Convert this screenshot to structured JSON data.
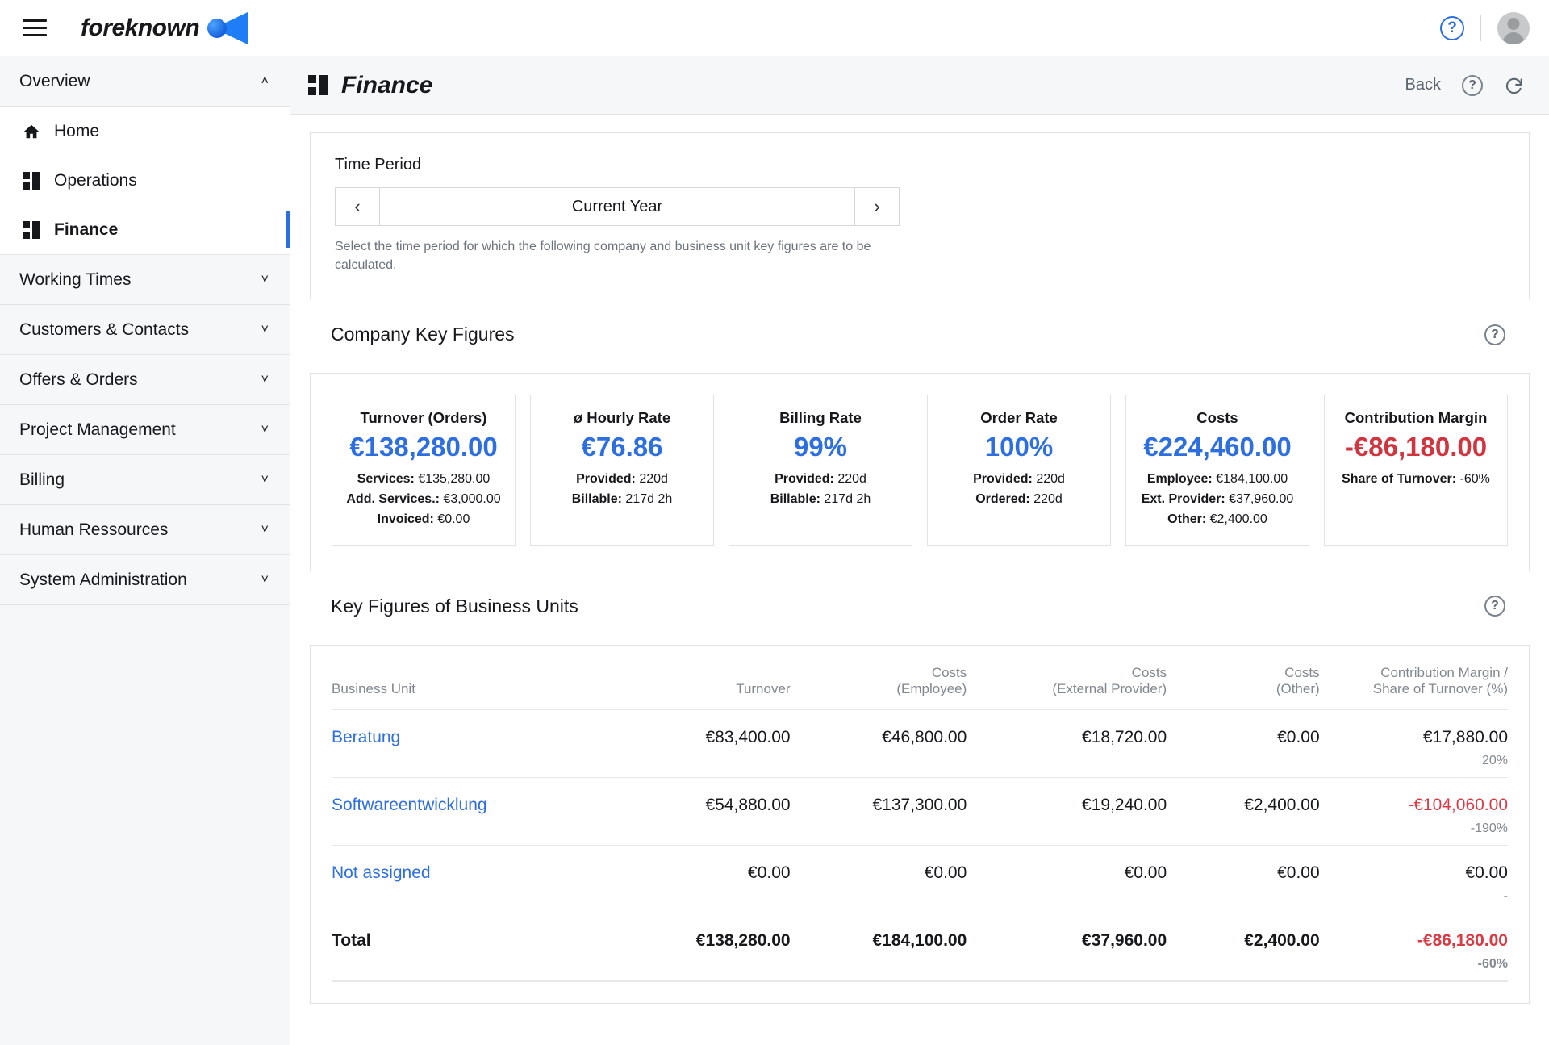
{
  "topbar": {
    "brand_name": "foreknown",
    "menu_icon": "hamburger-icon",
    "help_icon": "help-circle-icon",
    "avatar_icon": "user-avatar-icon"
  },
  "sidebar": {
    "groups": [
      {
        "label": "Overview",
        "expanded": true,
        "chevron": "˄",
        "items": [
          {
            "label": "Home",
            "icon": "home-icon",
            "active": false
          },
          {
            "label": "Operations",
            "icon": "grid-icon",
            "active": false
          },
          {
            "label": "Finance",
            "icon": "grid-icon",
            "active": true
          }
        ]
      },
      {
        "label": "Working Times",
        "expanded": false,
        "chevron": "˅",
        "items": []
      },
      {
        "label": "Customers & Contacts",
        "expanded": false,
        "chevron": "˅",
        "items": []
      },
      {
        "label": "Offers & Orders",
        "expanded": false,
        "chevron": "˅",
        "items": []
      },
      {
        "label": "Project Management",
        "expanded": false,
        "chevron": "˅",
        "items": []
      },
      {
        "label": "Billing",
        "expanded": false,
        "chevron": "˅",
        "items": []
      },
      {
        "label": "Human Ressources",
        "expanded": false,
        "chevron": "˅",
        "items": []
      },
      {
        "label": "System Administration",
        "expanded": false,
        "chevron": "˅",
        "items": []
      }
    ]
  },
  "page": {
    "title": "Finance",
    "title_icon": "grid-icon",
    "back_label": "Back",
    "help_icon": "help-circle-icon",
    "refresh_icon": "refresh-icon"
  },
  "time_period": {
    "label": "Time Period",
    "prev_icon": "chevron-left-icon",
    "next_icon": "chevron-right-icon",
    "value": "Current Year",
    "hint": "Select the time period for which the following company and business unit key figures are to be calculated."
  },
  "company_key_figures": {
    "title": "Company Key Figures",
    "help_icon": "help-circle-icon",
    "cards": [
      {
        "title": "Turnover (Orders)",
        "value": "€138,280.00",
        "negative": false,
        "details": [
          {
            "label": "Services:",
            "value": "€135,280.00"
          },
          {
            "label": "Add. Services.:",
            "value": "€3,000.00"
          },
          {
            "label": "Invoiced:",
            "value": "€0.00"
          }
        ]
      },
      {
        "title": "ø Hourly Rate",
        "value": "€76.86",
        "negative": false,
        "details": [
          {
            "label": "Provided:",
            "value": "220d"
          },
          {
            "label": "Billable:",
            "value": "217d 2h"
          }
        ]
      },
      {
        "title": "Billing Rate",
        "value": "99%",
        "negative": false,
        "details": [
          {
            "label": "Provided:",
            "value": "220d"
          },
          {
            "label": "Billable:",
            "value": "217d 2h"
          }
        ]
      },
      {
        "title": "Order Rate",
        "value": "100%",
        "negative": false,
        "details": [
          {
            "label": "Provided:",
            "value": "220d"
          },
          {
            "label": "Ordered:",
            "value": "220d"
          }
        ]
      },
      {
        "title": "Costs",
        "value": "€224,460.00",
        "negative": false,
        "details": [
          {
            "label": "Employee:",
            "value": "€184,100.00"
          },
          {
            "label": "Ext. Provider:",
            "value": "€37,960.00"
          },
          {
            "label": "Other:",
            "value": "€2,400.00"
          }
        ]
      },
      {
        "title": "Contribution Margin",
        "value": "-€86,180.00",
        "negative": true,
        "details": [
          {
            "label": "Share of Turnover:",
            "value": "-60%"
          }
        ]
      }
    ]
  },
  "business_units": {
    "title": "Key Figures of Business Units",
    "help_icon": "help-circle-icon",
    "columns": [
      {
        "line1": "",
        "line2": "Business Unit",
        "align": "l"
      },
      {
        "line1": "",
        "line2": "Turnover",
        "align": "r"
      },
      {
        "line1": "Costs",
        "line2": "(Employee)",
        "align": "r"
      },
      {
        "line1": "Costs",
        "line2": "(External Provider)",
        "align": "r"
      },
      {
        "line1": "Costs",
        "line2": "(Other)",
        "align": "r"
      },
      {
        "line1": "Contribution Margin /",
        "line2": "Share of Turnover (%)",
        "align": "r"
      }
    ],
    "rows": [
      {
        "unit": "Beratung",
        "is_link": true,
        "is_total": false,
        "turnover": "€83,400.00",
        "cost_employee": "€46,800.00",
        "cost_external": "€18,720.00",
        "cost_other": "€0.00",
        "contribution_margin": "€17,880.00",
        "margin_negative": false,
        "share_pct": "20%"
      },
      {
        "unit": "Softwareentwicklung",
        "is_link": true,
        "is_total": false,
        "turnover": "€54,880.00",
        "cost_employee": "€137,300.00",
        "cost_external": "€19,240.00",
        "cost_other": "€2,400.00",
        "contribution_margin": "-€104,060.00",
        "margin_negative": true,
        "share_pct": "-190%"
      },
      {
        "unit": "Not assigned",
        "is_link": true,
        "is_total": false,
        "turnover": "€0.00",
        "cost_employee": "€0.00",
        "cost_external": "€0.00",
        "cost_other": "€0.00",
        "contribution_margin": "€0.00",
        "margin_negative": false,
        "share_pct": "-"
      },
      {
        "unit": "Total",
        "is_link": false,
        "is_total": true,
        "turnover": "€138,280.00",
        "cost_employee": "€184,100.00",
        "cost_external": "€37,960.00",
        "cost_other": "€2,400.00",
        "contribution_margin": "-€86,180.00",
        "margin_negative": true,
        "share_pct": "-60%"
      }
    ]
  },
  "colors": {
    "accent": "#2d6fe0",
    "negative": "#d0353f",
    "muted": "#81888f"
  }
}
